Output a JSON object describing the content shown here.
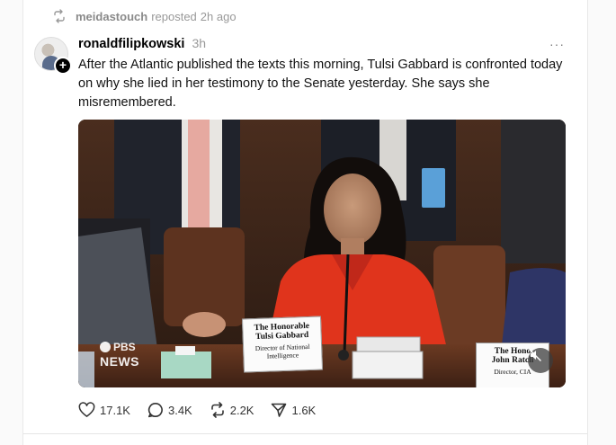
{
  "repost": {
    "user": "meidastouch",
    "text": "reposted",
    "time": "2h ago"
  },
  "post": {
    "author": "ronaldfilipkowski",
    "time": "3h",
    "text": "After the Atlantic published the texts this morning, Tulsi Gabbard is confronted today on why she lied in her testimony to the Senate yesterday. She says she misremembered.",
    "more_label": "···"
  },
  "video": {
    "placard_main": {
      "line1": "The Honorable",
      "line2": "Tulsi Gabbard",
      "line3": "Director of National Intelligence"
    },
    "placard_side": {
      "line1": "The Hono",
      "line2": "John Ratcli",
      "line3": "Director, CIA"
    },
    "watermark_top": "PBS",
    "watermark_bottom": "NEWS",
    "muted": true
  },
  "actions": {
    "likes": "17.1K",
    "replies": "3.4K",
    "reposts": "2.2K",
    "shares": "1.6K"
  },
  "icons": {
    "repost": "repost-icon",
    "like": "heart-icon",
    "reply": "comment-icon",
    "repost_action": "repost-icon",
    "share": "send-icon",
    "mute": "speaker-muted-icon",
    "follow": "plus-icon"
  },
  "colors": {
    "muted_text": "#999999",
    "suit_red": "#e0341c",
    "background": "#ffffff"
  }
}
